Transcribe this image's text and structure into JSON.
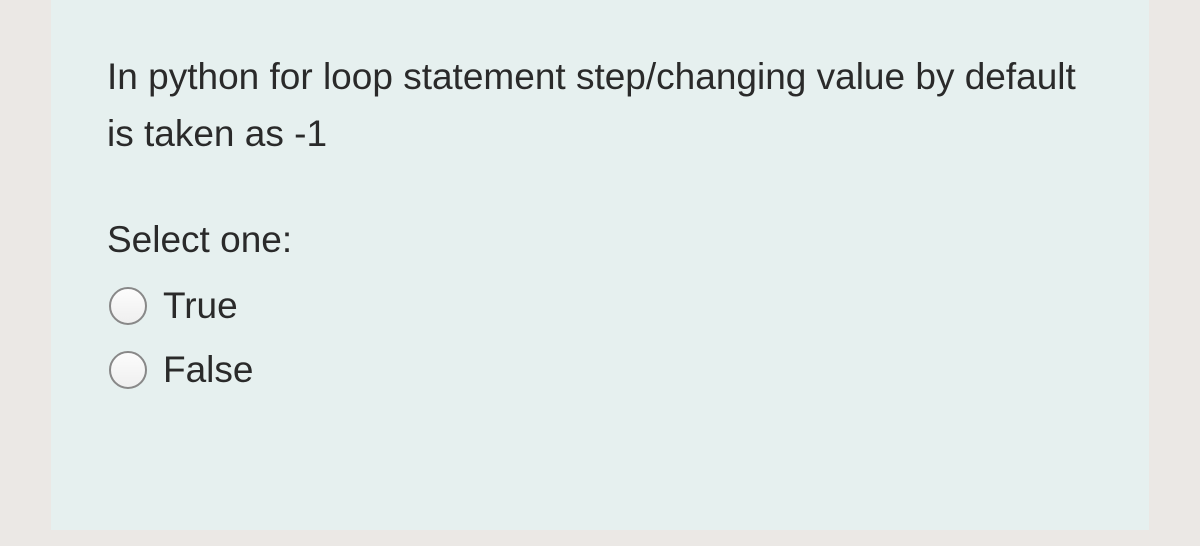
{
  "question": {
    "text": "In python for loop statement step/changing value by default is taken as -1",
    "select_prompt": "Select one:",
    "options": [
      {
        "label": "True"
      },
      {
        "label": "False"
      }
    ]
  }
}
